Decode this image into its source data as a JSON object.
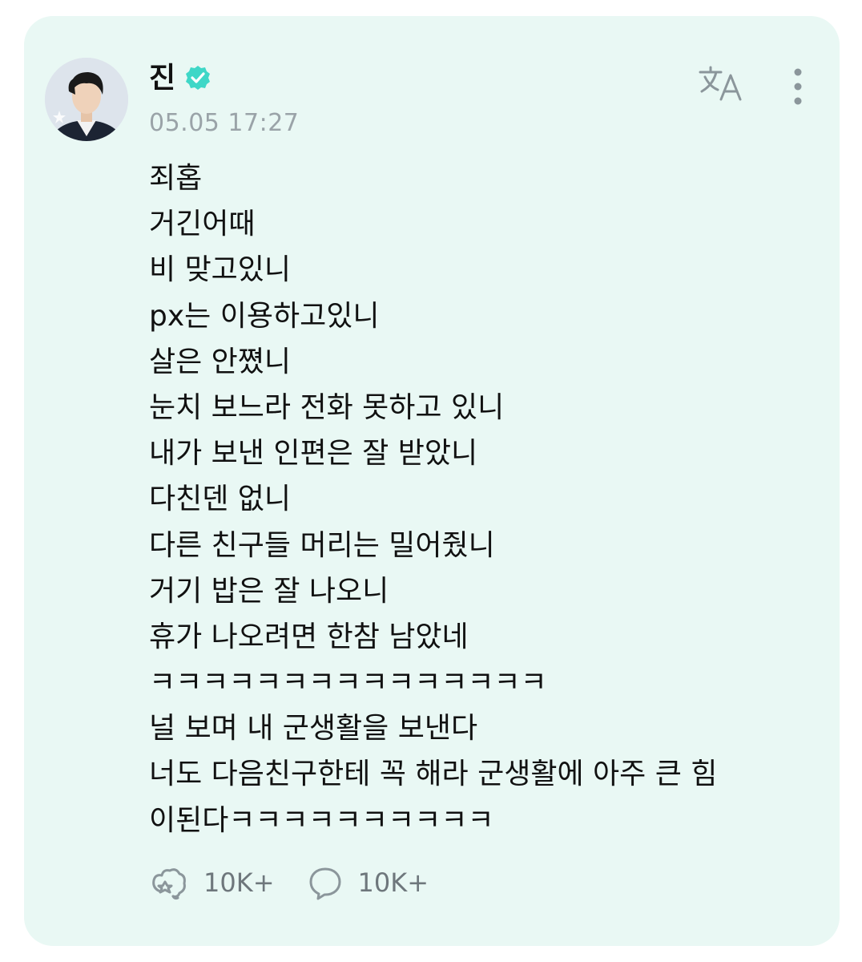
{
  "post": {
    "author": {
      "name": "진",
      "verified": true,
      "avatar_icon": "profile-photo"
    },
    "timestamp": "05.05 17:27",
    "icons": {
      "translate": "translate-icon",
      "more": "more-vertical-icon"
    },
    "body_lines": [
      "죄홉",
      "거긴어때",
      "비 맞고있니",
      "px는 이용하고있니",
      "살은 안쪘니",
      "눈치 보느라 전화 못하고 있니",
      "내가 보낸 인편은 잘 받았니",
      "다친덴 없니",
      "다른 친구들 머리는 밀어줬니",
      "거기 밥은 잘 나오니",
      "휴가 나오려면 한참 남았네",
      "ㅋㅋㅋㅋㅋㅋㅋㅋㅋㅋㅋㅋㅋㅋㅋ",
      "널 보며 내 군생활을 보낸다",
      "너도 다음친구한테 꼭 해라 군생활에 아주 큰 힘",
      "이된다ㅋㅋㅋㅋㅋㅋㅋㅋㅋㅋ"
    ],
    "actions": {
      "like_count": "10K+",
      "comment_count": "10K+"
    }
  },
  "colors": {
    "card_background": "#e9f8f4",
    "verified_badge": "#3fd7c7",
    "timestamp": "#9aa3a8",
    "icon": "#8b969b"
  }
}
